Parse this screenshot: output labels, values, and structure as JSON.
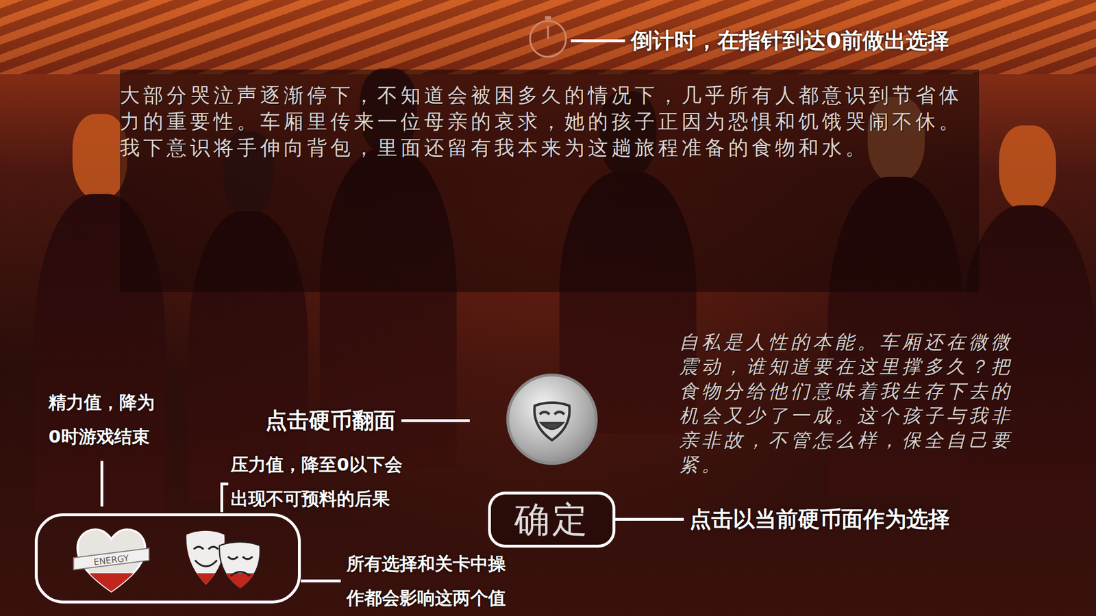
{
  "timer": {
    "annotation": "倒计时，在指针到达0前做出选择"
  },
  "narrative": "大部分哭泣声逐渐停下，不知道会被困多久的情况下，几乎所有人都意识到节省体力的重要性。车厢里传来一位母亲的哀求，她的孩子正因为恐惧和饥饿哭闹不休。我下意识将手伸向背包，里面还留有我本来为这趟旅程准备的食物和水。",
  "inner_voice": "自私是人性的本能。车厢还在微微震动，谁知道要在这里撑多久？把食物分给他们意味着我生存下去的机会又少了一成。这个孩子与我非亲非故，不管怎么样，保全自己要紧。",
  "coin": {
    "annotation": "点击硬币翻面"
  },
  "confirm": {
    "label": "确定",
    "annotation": "点击以当前硬币面作为选择"
  },
  "stats": [
    {
      "name": "energy",
      "ribbon": "ENERGY",
      "level": 0.3,
      "annotation": [
        "精力值，降为",
        "0时游戏结束"
      ]
    },
    {
      "name": "stress",
      "ribbon": "",
      "level": 0.28,
      "annotation": [
        "压力值，降至0以下会",
        "出现不可预料的后果"
      ]
    }
  ],
  "stats_annotation": [
    "所有选择和关卡中操",
    "作都会影响这两个值"
  ]
}
